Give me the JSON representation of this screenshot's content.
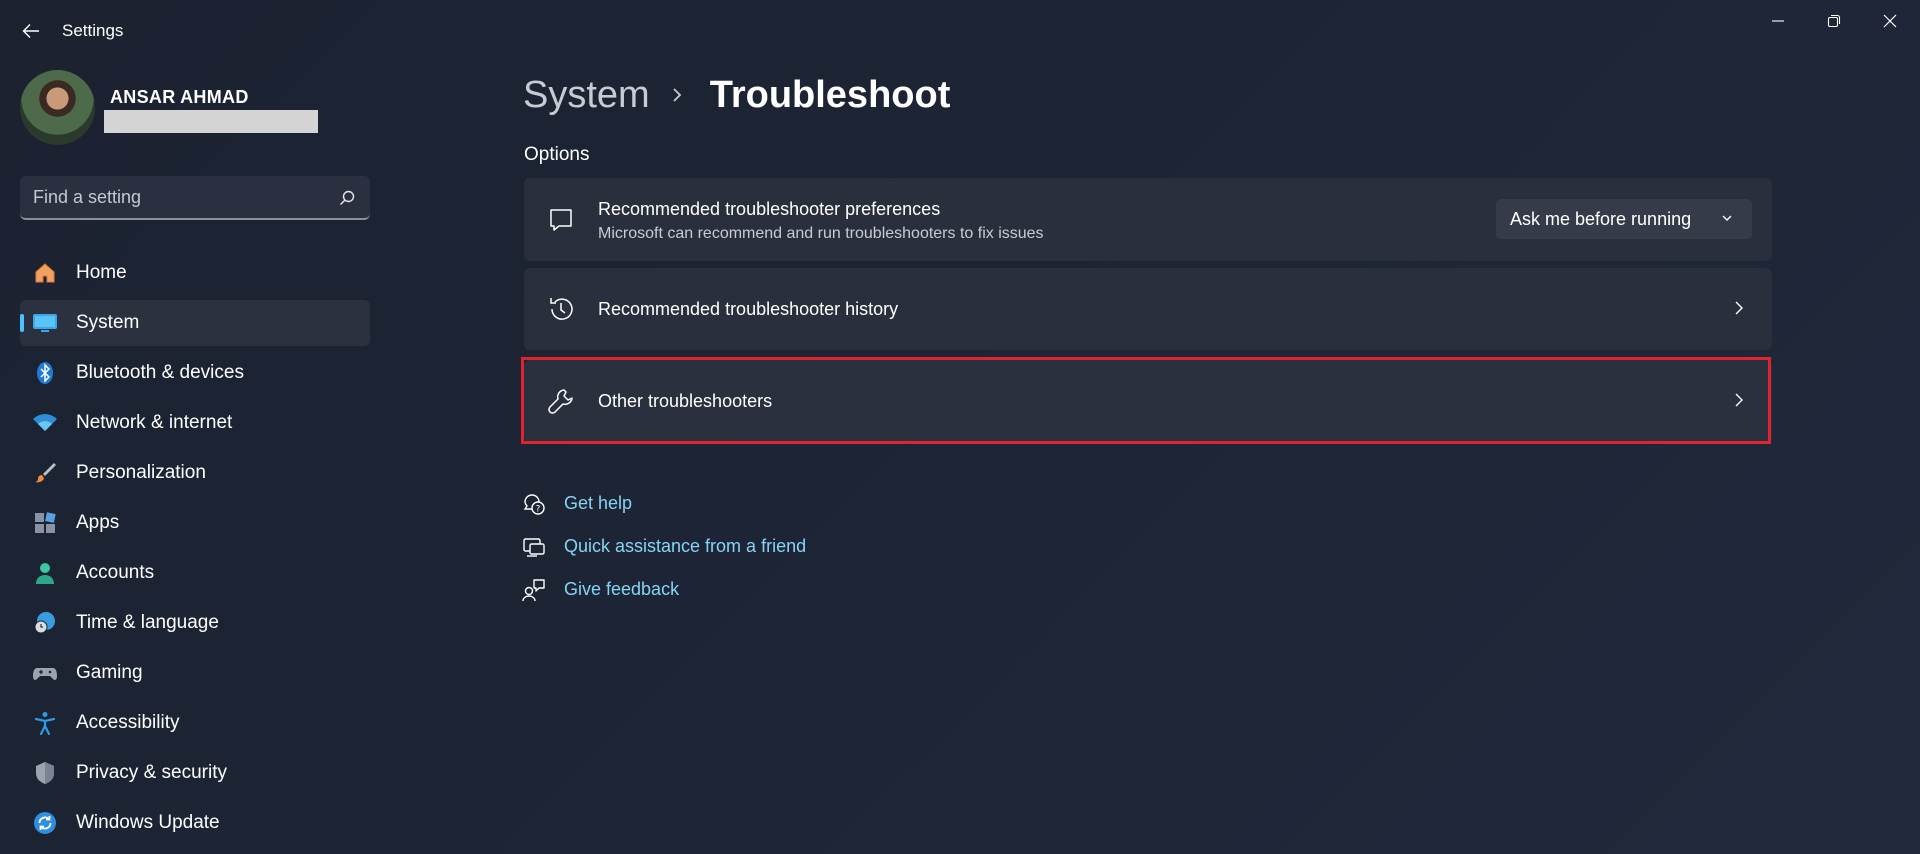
{
  "window": {
    "title": "Settings"
  },
  "profile": {
    "name": "ANSAR AHMAD"
  },
  "search": {
    "placeholder": "Find a setting"
  },
  "sidebar": {
    "items": [
      {
        "label": "Home",
        "icon": "home-icon",
        "active": false
      },
      {
        "label": "System",
        "icon": "system-icon",
        "active": true
      },
      {
        "label": "Bluetooth & devices",
        "icon": "bluetooth-icon",
        "active": false
      },
      {
        "label": "Network & internet",
        "icon": "wifi-icon",
        "active": false
      },
      {
        "label": "Personalization",
        "icon": "brush-icon",
        "active": false
      },
      {
        "label": "Apps",
        "icon": "apps-icon",
        "active": false
      },
      {
        "label": "Accounts",
        "icon": "person-icon",
        "active": false
      },
      {
        "label": "Time & language",
        "icon": "globe-clock-icon",
        "active": false
      },
      {
        "label": "Gaming",
        "icon": "gamepad-icon",
        "active": false
      },
      {
        "label": "Accessibility",
        "icon": "accessibility-icon",
        "active": false
      },
      {
        "label": "Privacy & security",
        "icon": "shield-icon",
        "active": false
      },
      {
        "label": "Windows Update",
        "icon": "update-icon",
        "active": false
      }
    ]
  },
  "breadcrumb": {
    "parent": "System",
    "current": "Troubleshoot"
  },
  "main": {
    "section_label": "Options",
    "cards": [
      {
        "title": "Recommended troubleshooter preferences",
        "subtitle": "Microsoft can recommend and run troubleshooters to fix issues",
        "icon": "chat-bubble-icon",
        "dropdown_value": "Ask me before running"
      },
      {
        "title": "Recommended troubleshooter history",
        "icon": "history-icon"
      },
      {
        "title": "Other troubleshooters",
        "icon": "wrench-icon",
        "highlighted": true
      }
    ],
    "help_links": [
      {
        "label": "Get help",
        "icon": "help-chat-icon"
      },
      {
        "label": "Quick assistance from a friend",
        "icon": "quick-assist-icon"
      },
      {
        "label": "Give feedback",
        "icon": "feedback-icon"
      }
    ]
  },
  "colors": {
    "accent": "#4cc2ff",
    "link": "#86d4f5",
    "highlight": "#e0232e",
    "card_bg": "#2a2f3d"
  }
}
